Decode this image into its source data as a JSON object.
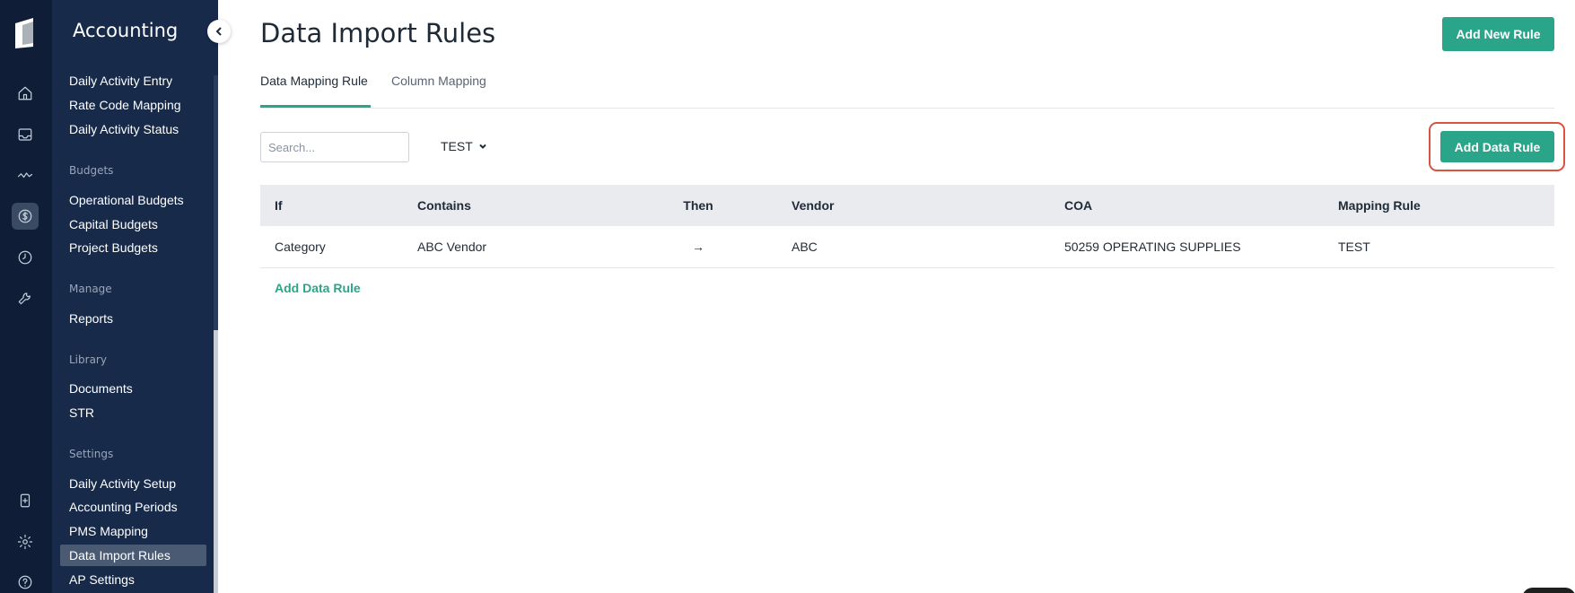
{
  "sidebar": {
    "title": "Accounting",
    "items": [
      {
        "label": "Daily Activity Entry"
      },
      {
        "label": "Rate Code Mapping"
      },
      {
        "label": "Daily Activity Status"
      }
    ],
    "sections": {
      "budgets": {
        "title": "Budgets",
        "items": [
          "Operational Budgets",
          "Capital Budgets",
          "Project Budgets"
        ]
      },
      "manage": {
        "title": "Manage",
        "items": [
          "Reports"
        ]
      },
      "library": {
        "title": "Library",
        "items": [
          "Documents",
          "STR"
        ]
      },
      "settings": {
        "title": "Settings",
        "items": [
          "Daily Activity Setup",
          "Accounting Periods",
          "PMS Mapping",
          "Data Import Rules",
          "AP Settings"
        ]
      }
    },
    "active_item": "Data Import Rules"
  },
  "rail_icons": [
    "logo-icon",
    "home-icon",
    "inbox-icon",
    "activity-icon",
    "dollar-icon",
    "clock-icon",
    "wrench-icon",
    "device-icon",
    "gear-icon",
    "help-icon"
  ],
  "header": {
    "title": "Data Import Rules",
    "add_new_rule": "Add New Rule"
  },
  "tabs": [
    {
      "label": "Data Mapping Rule",
      "active": true
    },
    {
      "label": "Column Mapping",
      "active": false
    }
  ],
  "toolbar": {
    "search_placeholder": "Search...",
    "filter_value": "TEST",
    "add_data_rule": "Add Data Rule"
  },
  "table": {
    "columns": [
      "If",
      "Contains",
      "Then",
      "Vendor",
      "COA",
      "Mapping Rule"
    ],
    "rows": [
      [
        "Category",
        "ABC Vendor",
        "→",
        "ABC",
        "50259 OPERATING SUPPLIES",
        "TEST"
      ]
    ],
    "add_link": "Add Data Rule"
  },
  "colors": {
    "accent": "#2aa58a",
    "sidebar": "#172a4a",
    "rail": "#0f1e36",
    "highlight": "#d9533f"
  }
}
